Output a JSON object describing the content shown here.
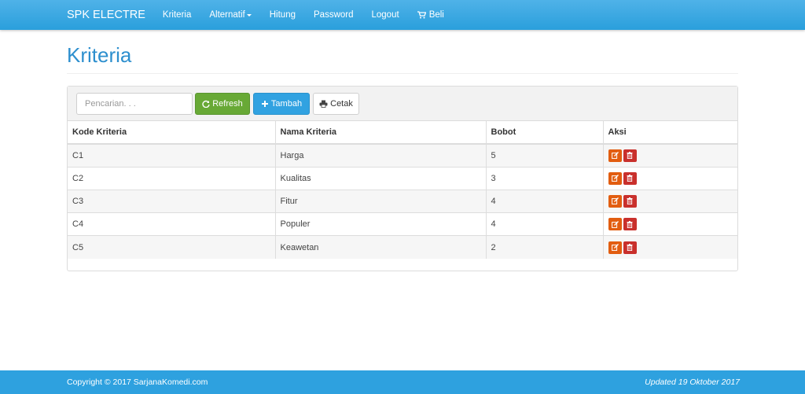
{
  "navbar": {
    "brand": "SPK ELECTRE",
    "items": [
      {
        "label": "Kriteria"
      },
      {
        "label": "Alternatif"
      },
      {
        "label": "Hitung"
      },
      {
        "label": "Password"
      },
      {
        "label": "Logout"
      },
      {
        "label": "Beli"
      }
    ],
    "color": "#2a9fdc"
  },
  "page": {
    "title": "Kriteria"
  },
  "toolbar": {
    "search_placeholder": "Pencarian. . .",
    "refresh_label": "Refresh",
    "tambah_label": "Tambah",
    "cetak_label": "Cetak"
  },
  "table": {
    "headers": [
      "Kode Kriteria",
      "Nama Kriteria",
      "Bobot",
      "Aksi"
    ],
    "rows": [
      {
        "kode": "C1",
        "nama": "Harga",
        "bobot": "5"
      },
      {
        "kode": "C2",
        "nama": "Kualitas",
        "bobot": "3"
      },
      {
        "kode": "C3",
        "nama": "Fitur",
        "bobot": "4"
      },
      {
        "kode": "C4",
        "nama": "Populer",
        "bobot": "4"
      },
      {
        "kode": "C5",
        "nama": "Keawetan",
        "bobot": "2"
      }
    ]
  },
  "icons": {
    "refresh": "refresh-icon",
    "tambah": "plus-icon",
    "cetak": "print-icon",
    "cart": "cart-icon",
    "edit": "edit-icon",
    "delete": "trash-icon"
  },
  "footer": {
    "copyright": "Copyright © 2017 SarjanaKomedi.com",
    "updated": "Updated 19 Oktober 2017"
  }
}
